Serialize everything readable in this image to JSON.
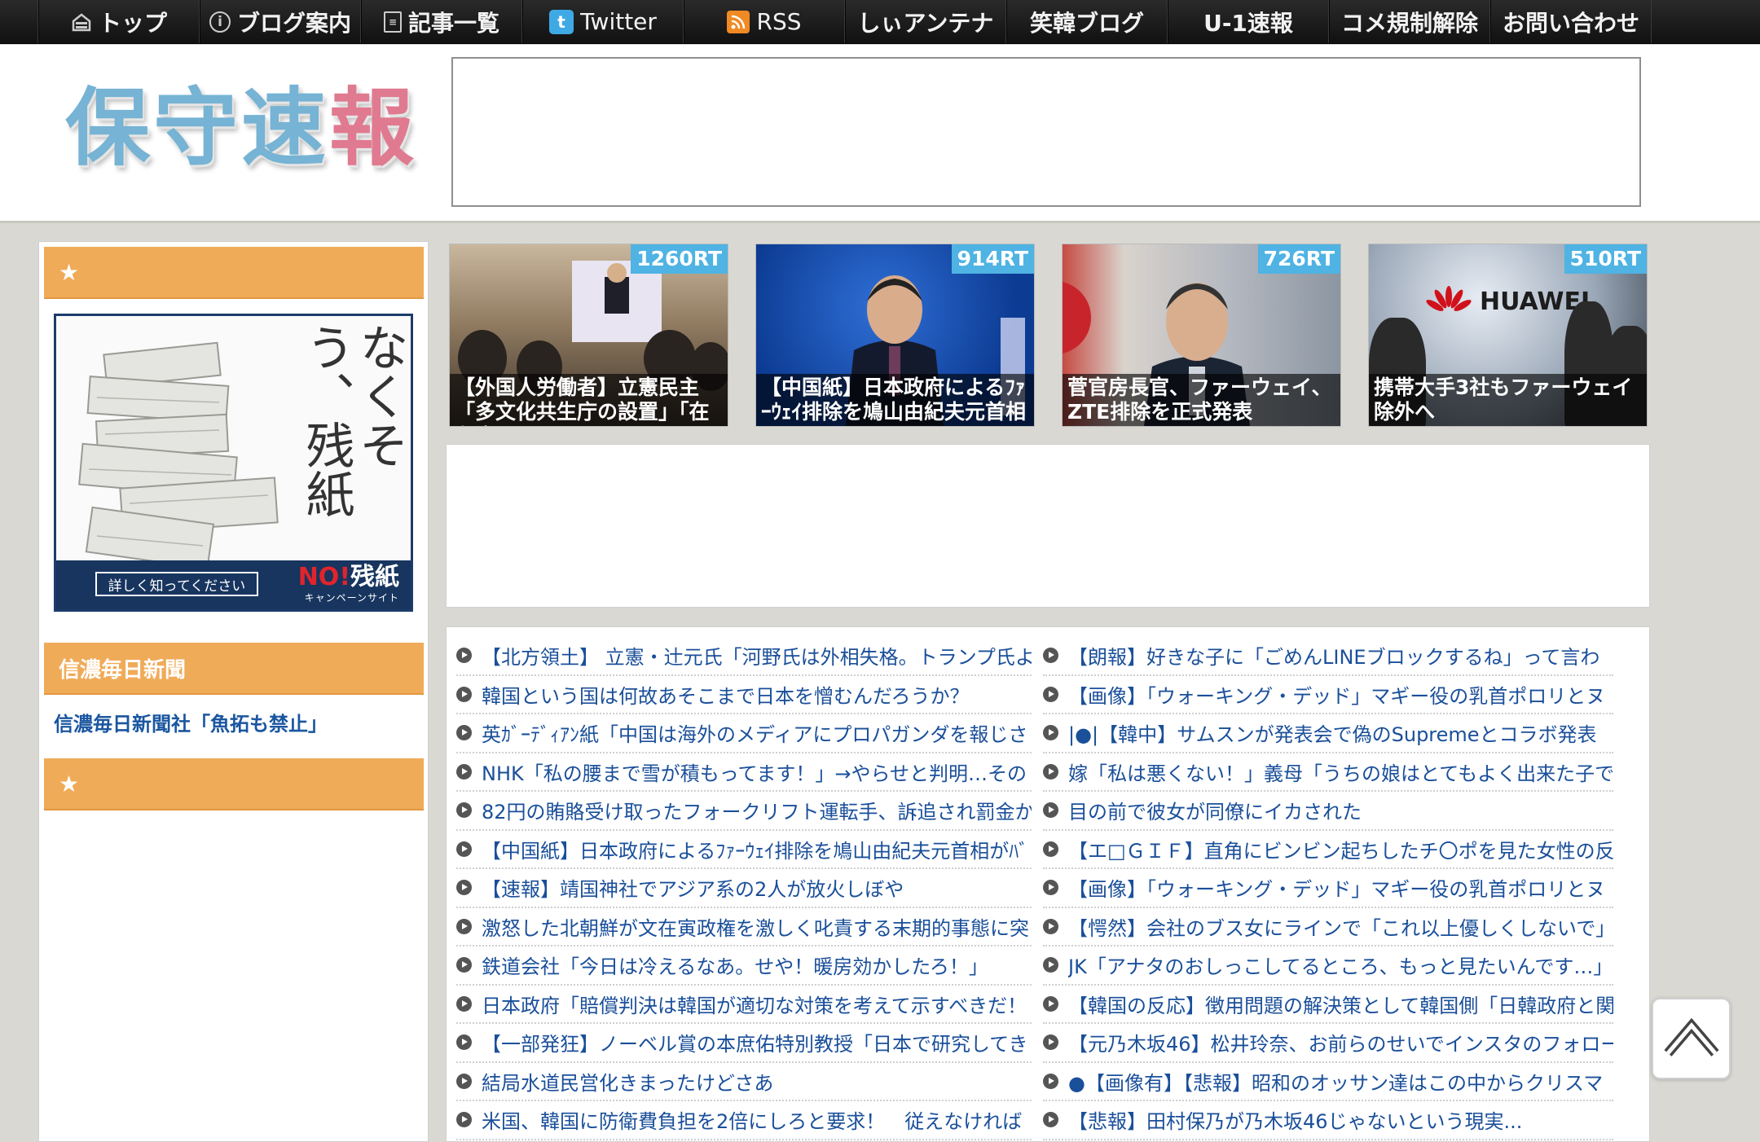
{
  "nav": {
    "items": [
      {
        "label": "トップ",
        "icon": "home-icon"
      },
      {
        "label": "ブログ案内",
        "icon": "info-icon"
      },
      {
        "label": "記事一覧",
        "icon": "document-icon"
      },
      {
        "label": "Twitter",
        "icon": "twitter-icon"
      },
      {
        "label": "RSS",
        "icon": "rss-icon"
      },
      {
        "label": "しぃアンテナ",
        "icon": ""
      },
      {
        "label": "笑韓ブログ",
        "icon": ""
      },
      {
        "label": "U-1速報",
        "icon": ""
      },
      {
        "label": "コメ規制解除",
        "icon": ""
      },
      {
        "label": "お問い合わせ",
        "icon": ""
      }
    ]
  },
  "header": {
    "logo_part1": "保守速",
    "logo_part2": "報"
  },
  "sidebar": {
    "star": "★",
    "banner": {
      "vertical_text": "なくそう、残紙",
      "button_label": "詳しく知ってください",
      "brand_no": "NO!",
      "brand_main": "残紙",
      "brand_sub": "キャンペーンサイト"
    },
    "section2_title": "信濃毎日新聞",
    "section2_link": "信濃毎日新聞社「魚拓も禁止」",
    "section3_star": "★"
  },
  "thumbnails": [
    {
      "rt": "1260RT",
      "caption": "【外国人労働者】立憲民主「多文化共生庁の設置」「在留資"
    },
    {
      "rt": "914RT",
      "caption": "【中国紙】日本政府によるﾌｧｰｳｪｲ排除を鳩山由紀夫元首相"
    },
    {
      "rt": "726RT",
      "caption": "菅官房長官、ファーウェイ、ZTE排除を正式発表"
    },
    {
      "rt": "510RT",
      "caption": "携帯大手3社もファーウェイ除外へ",
      "logo": "HUAWEI"
    }
  ],
  "articles_left": [
    "【北方領土】 立憲・辻元氏「河野氏は外相失格。トランプ氏よ",
    "韓国という国は何故あそこまで日本を憎むんだろうか？",
    "英ｶﾞｰﾃﾞｨｱﾝ紙「中国は海外のメディアにプロパガンダを報じさ",
    "NHK「私の腰まで雪が積もってます！」→やらせと判明…その",
    "82円の賄賂受け取ったフォークリフト運転手、訴追され罰金か",
    "【中国紙】日本政府によるﾌｧｰｳｪｲ排除を鳩山由紀夫元首相がﾊﾞ",
    "【速報】靖国神社でアジア系の2人が放火しぼや",
    "激怒した北朝鮮が文在寅政権を激しく叱責する末期的事態に突",
    "鉄道会社「今日は冷えるなあ。せや！暖房効かしたろ！」",
    "日本政府「賠償判決は韓国が適切な対策を考えて示すべきだ！",
    "【一部発狂】ノーベル賞の本庶佑特別教授「日本で研究してき",
    "結局水道民営化きまったけどさあ",
    "米国、韓国に防衛費負担を2倍にしろと要求！　従えなければ"
  ],
  "articles_right": [
    "【朗報】好きな子に「ごめんLINEブロックするね」って言わ",
    "【画像】「ウォーキング・デッド」マギー役の乳首ポロリとヌ",
    "|●|【韓中】サムスンが発表会で偽のSupremeとコラボ発表",
    "嫁「私は悪くない！」義母「うちの娘はとてもよく出来た子で",
    "目の前で彼女が同僚にイカされた",
    "【エ□ＧＩＦ】直角にビンビン起ちしたチ〇ポを見た女性の反",
    "【画像】「ウォーキング・デッド」マギー役の乳首ポロリとヌ",
    "【愕然】会社のブス女にラインで「これ以上優しくしないで」",
    "JK「アナタのおしっこしてるところ、もっと見たいんです…」",
    "【韓国の反応】徴用問題の解決策として韓国側「日韓政府と関",
    "【元乃木坂46】松井玲奈、お前らのせいでインスタのフォロー",
    "●【画像有】【悲報】昭和のオッサン達はこの中からクリスマ",
    "【悲報】田村保乃が乃木坂46じゃないという現実..."
  ],
  "colors": {
    "accent_orange": "#f0ab59",
    "link_blue": "#1a4f9a",
    "rt_badge": "#4fb3e3"
  }
}
